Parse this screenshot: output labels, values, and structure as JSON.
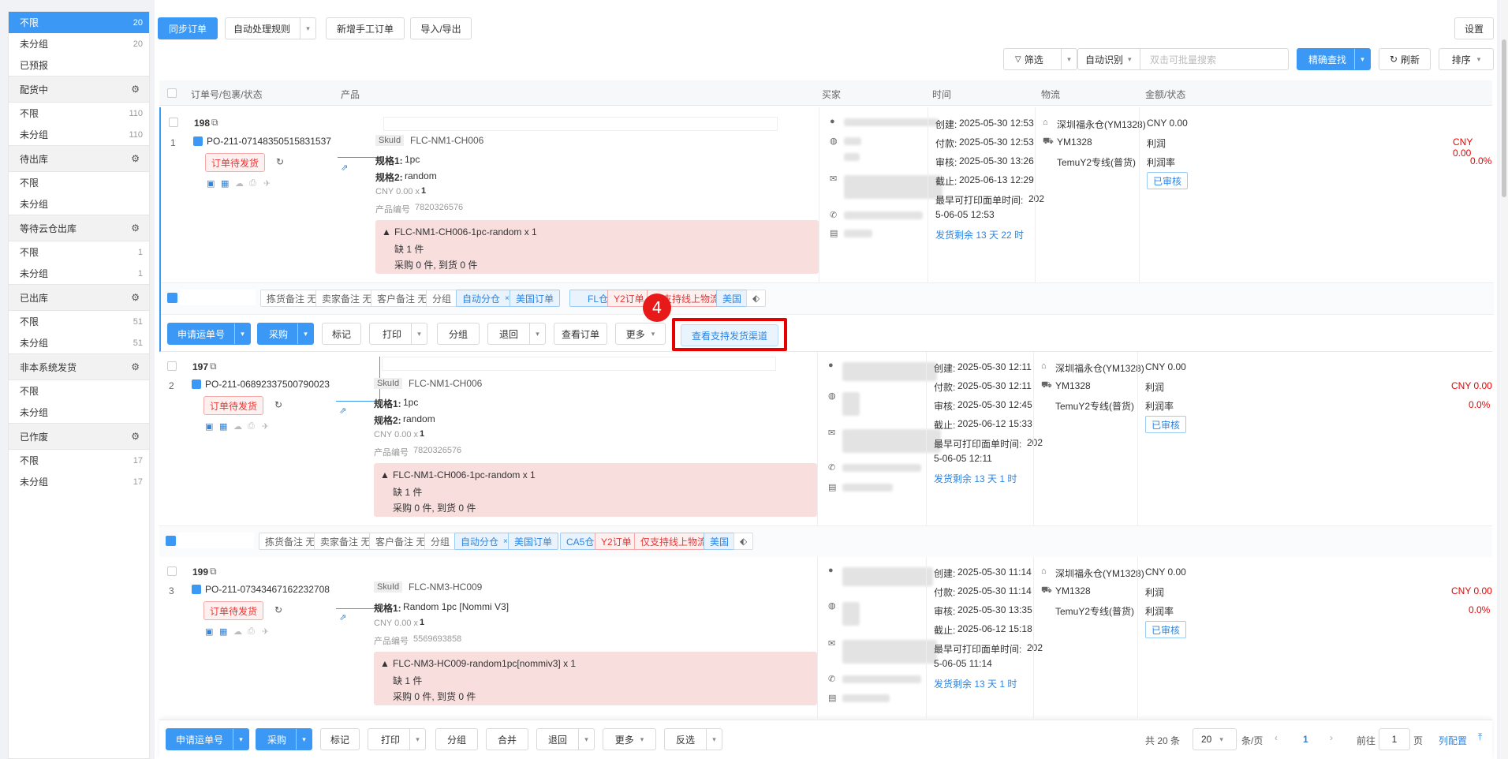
{
  "sidebar": {
    "top": [
      {
        "label": "不限",
        "count": "20"
      },
      {
        "label": "未分组",
        "count": "20"
      },
      {
        "label": "已预报",
        "count": ""
      }
    ],
    "groups": [
      {
        "title": "配货中",
        "items": [
          {
            "label": "不限",
            "count": "110"
          },
          {
            "label": "未分组",
            "count": "110"
          }
        ]
      },
      {
        "title": "待出库",
        "items": [
          {
            "label": "不限",
            "count": ""
          },
          {
            "label": "未分组",
            "count": ""
          }
        ]
      },
      {
        "title": "等待云仓出库",
        "items": [
          {
            "label": "不限",
            "count": "1"
          },
          {
            "label": "未分组",
            "count": "1"
          }
        ]
      },
      {
        "title": "已出库",
        "items": [
          {
            "label": "不限",
            "count": "51"
          },
          {
            "label": "未分组",
            "count": "51"
          }
        ]
      },
      {
        "title": "非本系统发货",
        "items": [
          {
            "label": "不限",
            "count": ""
          },
          {
            "label": "未分组",
            "count": ""
          }
        ]
      },
      {
        "title": "已作废",
        "items": [
          {
            "label": "不限",
            "count": "17"
          },
          {
            "label": "未分组",
            "count": "17"
          }
        ]
      }
    ]
  },
  "toolbar": {
    "sync": "同步订单",
    "auto": "自动处理规则",
    "manual": "新增手工订单",
    "import": "导入/导出",
    "settings": "设置",
    "filter": "筛选",
    "autorecog": "自动识别",
    "search_placeholder": "双击可批量搜索",
    "precise": "精确查找",
    "refresh": "刷新",
    "sort": "排序"
  },
  "headers": {
    "order": "订单号/包裹/状态",
    "product": "产品",
    "buyer": "买家",
    "time": "时间",
    "logistics": "物流",
    "amount": "金额/状态"
  },
  "common": {
    "status": "订单待发货",
    "sku_label": "SkuId",
    "spec1_label": "规格1:",
    "spec2_label": "规格2:",
    "price": "CNY 0.00 x",
    "qty": "1",
    "product_no_label": "产品编号",
    "lack": "缺 1 件",
    "purchase": "采购 0 件, 到货 0 件",
    "created": "创建:",
    "paid": "付款:",
    "audited": "审核:",
    "deadline": "截止:",
    "earliest": "最早可打印面单时间:",
    "warehouse": "深圳福永仓(YM1328)",
    "carrier": "YM1328",
    "line": "TemuY2专线(普货)",
    "amount": "CNY 0.00",
    "profit_label": "利润",
    "profit": "CNY 0.00",
    "rate_label": "利润率",
    "rate": "0.0%",
    "audited_badge": "已审核",
    "pick_note": "拣货备注 无",
    "seller_note": "卖家备注 无",
    "cust_note": "客户备注 无",
    "group": "分组",
    "auto_wh": "自动分仓",
    "us_order": "美国订单",
    "y2": "Y2订单",
    "online": "仅支持线上物流",
    "us": "美国"
  },
  "orders": [
    {
      "num": "198",
      "idx": "1",
      "po": "PO-211-07148350515831537",
      "sku": "FLC-NM1-CH006",
      "spec1": "1pc",
      "spec2": "random",
      "pno": "7820326576",
      "warn": "FLC-NM1-CH006-1pc-random x 1",
      "t1": "2025-05-30 12:53",
      "t2": "2025-05-30 12:53",
      "t3": "2025-05-30 13:26",
      "t4": "2025-06-13 12:29",
      "t5a": "202",
      "t5b": "5-06-05 12:53",
      "left": "发货剩余 13 天 22 时",
      "wh_tag": "FL仓"
    },
    {
      "num": "197",
      "idx": "2",
      "po": "PO-211-06892337500790023",
      "sku": "FLC-NM1-CH006",
      "spec1": "1pc",
      "spec2": "random",
      "pno": "7820326576",
      "warn": "FLC-NM1-CH006-1pc-random x 1",
      "t1": "2025-05-30 12:11",
      "t2": "2025-05-30 12:11",
      "t3": "2025-05-30 12:45",
      "t4": "2025-06-12 15:33",
      "t5a": "202",
      "t5b": "5-06-05 12:11",
      "left": "发货剩余 13 天 1 时",
      "wh_tag": "CA5仓"
    },
    {
      "num": "199",
      "idx": "3",
      "po": "PO-211-07343467162232708",
      "sku": "FLC-NM3-HC009",
      "spec1": "Random 1pc [Nommi V3]",
      "spec2": "",
      "pno": "5569693858",
      "warn": "FLC-NM3-HC009-random1pc[nommiv3] x 1",
      "t1": "2025-05-30 11:14",
      "t2": "2025-05-30 11:14",
      "t3": "2025-05-30 13:35",
      "t4": "2025-06-12 15:18",
      "t5a": "202",
      "t5b": "5-06-05 11:14",
      "left": "发货剩余 13 天 1 时",
      "wh_tag": ""
    }
  ],
  "actions": {
    "waybill": "申请运单号",
    "purchase": "采购",
    "mark": "标记",
    "print": "打印",
    "group": "分组",
    "return": "退回",
    "view": "查看订单",
    "more": "更多",
    "channels": "查看支持发货渠道",
    "merge": "合并",
    "invert": "反选"
  },
  "annotation": {
    "step": "4"
  },
  "pager": {
    "total": "共 20 条",
    "size": "20",
    "unit": "条/页",
    "page": "1",
    "goto": "前往",
    "goto_val": "1",
    "page_unit": "页",
    "config": "列配置"
  }
}
